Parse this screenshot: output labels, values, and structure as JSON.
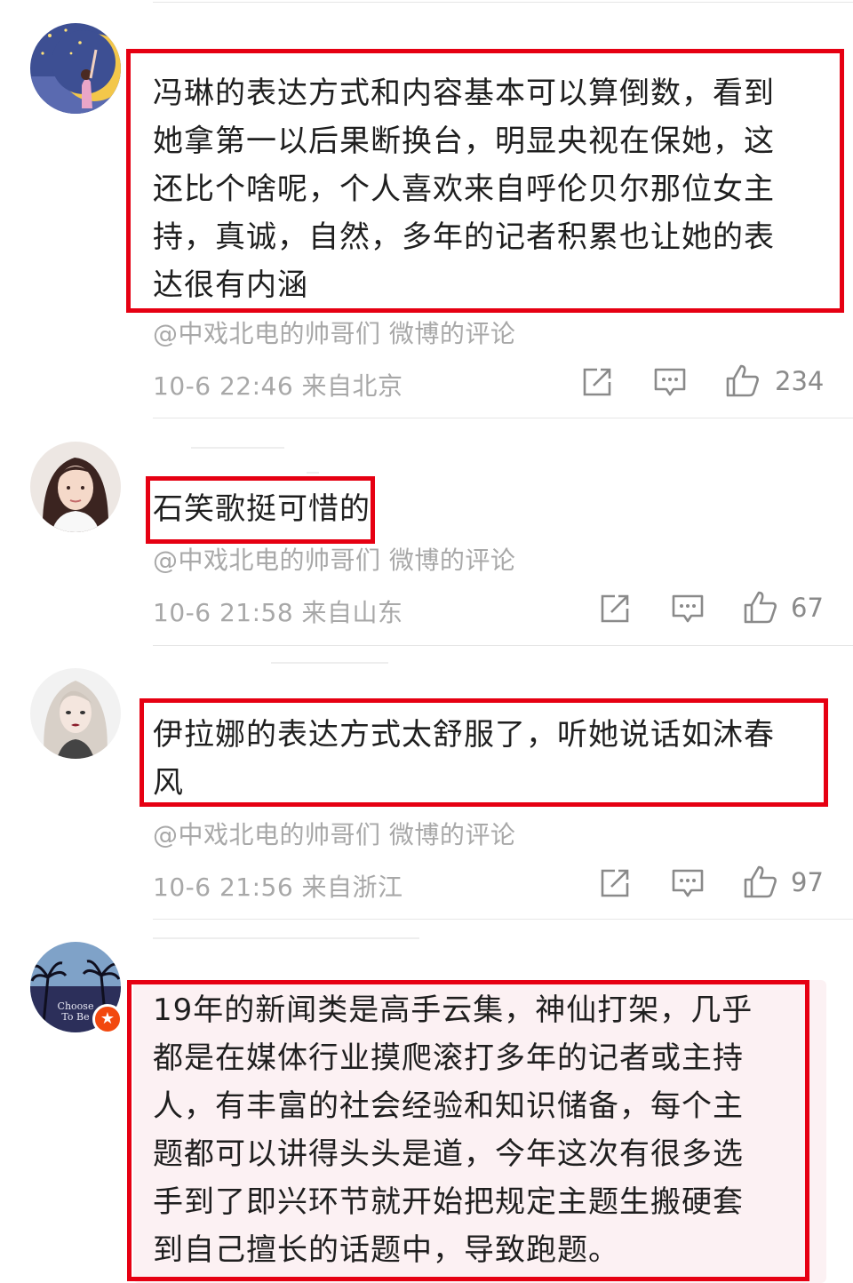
{
  "comments": [
    {
      "text_lines": [
        "冯琳的表达方式和内容基本可以算倒数，看到",
        "她拿第一以后果断换台，明显央视在保她，这",
        "还比个啥呢，个人喜欢来自呼伦贝尔那位女主",
        "持，真诚，自然，多年的记者积累也让她的表",
        "达很有内涵"
      ],
      "source": "@中戏北电的帅哥们 微博的评论",
      "time_location": "10-6 22:46 来自北京",
      "likes": "234",
      "avatar_icon": "moon-girl-avatar"
    },
    {
      "text_lines": [
        "石笑歌挺可惜的"
      ],
      "source": "@中戏北电的帅哥们 微博的评论",
      "time_location": "10-6 21:58 来自山东",
      "likes": "67",
      "avatar_icon": "woman-portrait-avatar"
    },
    {
      "text_lines": [
        "伊拉娜的表达方式太舒服了，听她说话如沐春",
        "风"
      ],
      "source": "@中戏北电的帅哥们 微博的评论",
      "time_location": "10-6 21:56 来自浙江",
      "likes": "97",
      "avatar_icon": "illustrated-girl-avatar"
    },
    {
      "text_lines": [
        "19年的新闻类是高手云集，神仙打架，几乎",
        "都是在媒体行业摸爬滚打多年的记者或主持",
        "人，有丰富的社会经验和知识储备，每个主",
        "题都可以讲得头头是道，今年这次有很多选",
        "手到了即兴环节就开始把规定主题生搬硬套",
        "到自己擅长的话题中，导致跑题。"
      ],
      "avatar_text": [
        "Choose",
        "To Be"
      ],
      "avatar_icon": "palm-trees-avatar",
      "badge_icon": "vip-star-badge"
    }
  ],
  "colors": {
    "highlight": "#e60012",
    "meta_text": "#a8a8a8",
    "body_text": "#1f1f1f",
    "divider": "#e6e6e6",
    "vip_badge": "#f2480f"
  }
}
